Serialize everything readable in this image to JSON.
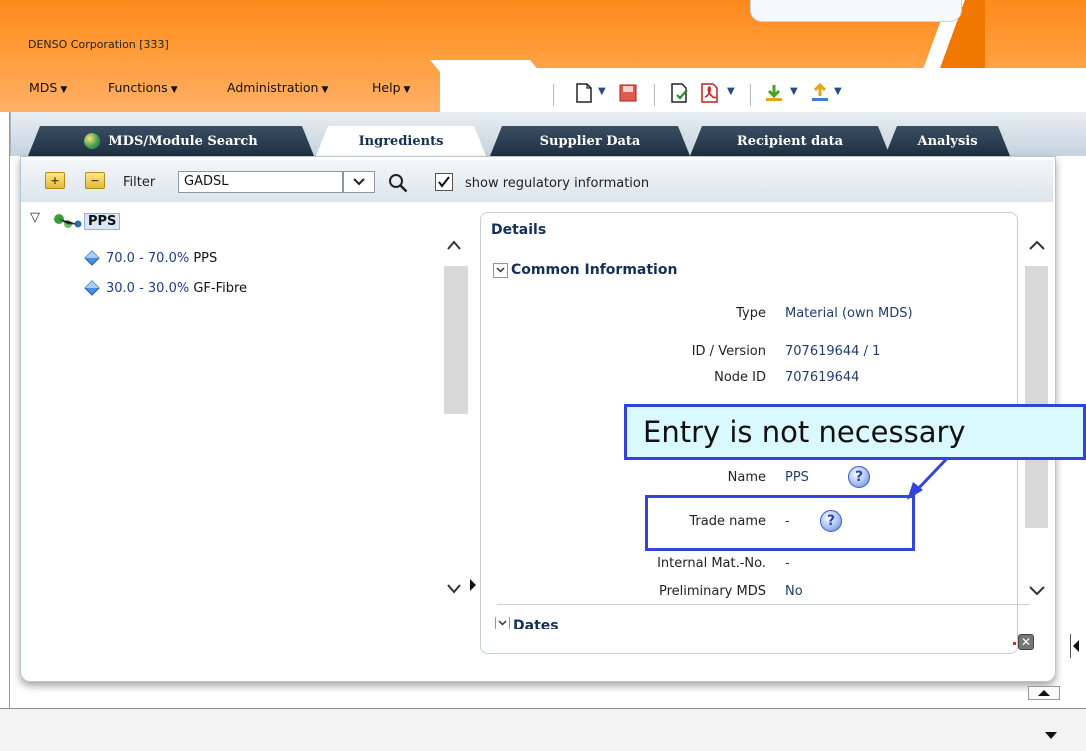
{
  "header": {
    "company": "DENSO Corporation [333]",
    "menu": [
      {
        "label": "MDS"
      },
      {
        "label": "Functions"
      },
      {
        "label": "Administration"
      },
      {
        "label": "Help"
      }
    ]
  },
  "tabs": [
    {
      "label": "MDS/Module Search",
      "active": false
    },
    {
      "label": "Ingredients",
      "active": true
    },
    {
      "label": "Supplier Data",
      "active": false
    },
    {
      "label": "Recipient data",
      "active": false
    },
    {
      "label": "Analysis",
      "active": false
    }
  ],
  "filterbar": {
    "expand_label": "+",
    "collapse_label": "−",
    "filter_label": "Filter",
    "filter_value": "GADSL",
    "show_regulatory_label": "show regulatory information",
    "show_regulatory_checked": true
  },
  "tree": {
    "root": "PPS",
    "children": [
      {
        "percent": "70.0 - 70.0%",
        "name": "PPS"
      },
      {
        "percent": "30.0 - 30.0%",
        "name": "GF-Fibre"
      }
    ]
  },
  "details": {
    "title": "Details",
    "section_common": "Common Information",
    "section_dates": "Dates",
    "fields": [
      {
        "label": "Type",
        "value": "Material (own MDS)"
      },
      {
        "label": "ID / Version",
        "value": "707619644 / 1"
      },
      {
        "label": "Node ID",
        "value": "707619644"
      },
      {
        "label": "Name",
        "value": "PPS"
      },
      {
        "label": "Trade name",
        "value": "-"
      },
      {
        "label": "Internal Mat.-No.",
        "value": "-"
      },
      {
        "label": "Preliminary MDS",
        "value": "No"
      }
    ]
  },
  "annotation": {
    "callout_text": "Entry is not necessary"
  },
  "colors": {
    "header_orange": "#ff8a1c",
    "tab_dark": "#1f3041",
    "callout_border": "#3344dd",
    "callout_fill": "#d9f9ff"
  }
}
